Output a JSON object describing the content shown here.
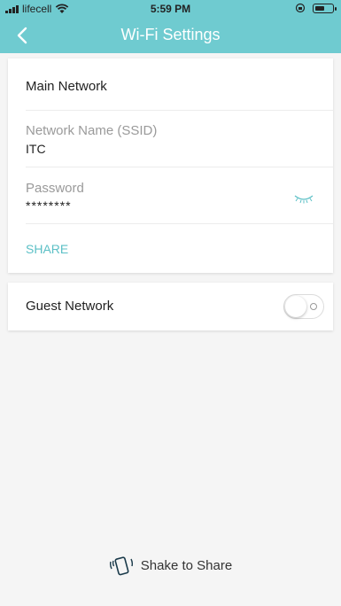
{
  "status_bar": {
    "carrier": "lifecell",
    "time": "5:59 PM"
  },
  "nav": {
    "title": "Wi-Fi Settings",
    "back_icon": "chevron-left-icon"
  },
  "main_network": {
    "section_label": "Main Network",
    "ssid_label": "Network Name (SSID)",
    "ssid_value": "ITC",
    "password_label": "Password",
    "password_value": "********",
    "share_label": "SHARE"
  },
  "guest_network": {
    "label": "Guest Network",
    "enabled": false
  },
  "footer": {
    "shake_label": "Shake to Share"
  },
  "colors": {
    "accent": "#6fcbd0",
    "share_text": "#5cc0c6"
  }
}
